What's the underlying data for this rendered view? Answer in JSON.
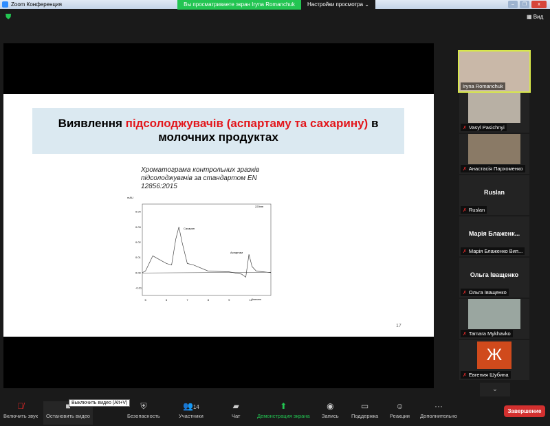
{
  "window": {
    "title": "Zoom Конференция",
    "banner": "Вы просматриваете экран Iryna Romanchuk",
    "view_settings": "Настройки просмотра ⌄",
    "view_button": "Вид"
  },
  "slide": {
    "title_part1": "Виявлення ",
    "title_red": "підсолоджувачів (аспартаму та сахарину)",
    "title_part2": " в молочних продуктах",
    "caption_lines": [
      "Хроматограма контрольних зразків",
      "підсолоджувачів за стандартом EN",
      "12856:2015"
    ],
    "page_number": "17"
  },
  "chart_data": {
    "type": "line",
    "ylabel": "mAU",
    "xlabel": "Хвилини",
    "wavelength_label": "220nm",
    "yticks": [
      "0.04",
      "0.03",
      "0.02",
      "0.01",
      "0.00",
      "-0.01"
    ],
    "xticks": [
      "5",
      "6",
      "7",
      "8",
      "9",
      "10"
    ],
    "peak_labels": [
      "Сахарин",
      "Аспартам"
    ],
    "ylim": [
      -0.015,
      0.045
    ],
    "xlim": [
      4.85,
      11
    ],
    "series": [
      {
        "name": "chromatogram",
        "x": [
          4.85,
          5.0,
          5.35,
          6.0,
          6.25,
          6.45,
          6.6,
          6.75,
          7.0,
          7.3,
          8.0,
          9.0,
          9.6,
          9.8,
          9.95,
          10.1,
          10.3,
          11
        ],
        "y": [
          0.0,
          0.001,
          0.011,
          0.006,
          0.005,
          0.022,
          0.03,
          0.02,
          0.006,
          0.005,
          0.001,
          0.0005,
          -0.001,
          -0.003,
          0.012,
          0.004,
          0.001,
          0.0
        ]
      }
    ]
  },
  "participants": [
    {
      "name": "Iryna Romanchuk",
      "video": true,
      "color": "#c9b8a8"
    },
    {
      "name": "Vasyl Pasichnyi",
      "video": true,
      "color": "#b8b0a4"
    },
    {
      "name": "Анастасія Пархоменко",
      "video": true,
      "color": "#8a7a66"
    },
    {
      "name": "Ruslan",
      "display": "Ruslan"
    },
    {
      "name": "Марія Блаженко Вип...",
      "display": "Марія  Блаженк..."
    },
    {
      "name": "Ольга Іващенко",
      "display": "Ольга Іващенко"
    },
    {
      "name": "Tamara Mykhavko",
      "video": true,
      "color": "#9aa6a0"
    },
    {
      "name": "Евгения Шубина",
      "avatar": "Ж",
      "color": "#d04a1c"
    }
  ],
  "toolbar": {
    "unmute": "Включить звук",
    "stop_video": "Остановить видео",
    "security": "Безопасность",
    "participants": "Участники",
    "participants_count": "14",
    "chat": "Чат",
    "share": "Демонстрация экрана",
    "record": "Запись",
    "support": "Поддержка",
    "reactions": "Реакции",
    "more": "Дополнительно",
    "end": "Завершение",
    "tooltip": "Выключить видео (Alt+V)"
  },
  "colors": {
    "accent": "#23c552",
    "end": "#d3302f",
    "title_red": "#e3161b"
  }
}
